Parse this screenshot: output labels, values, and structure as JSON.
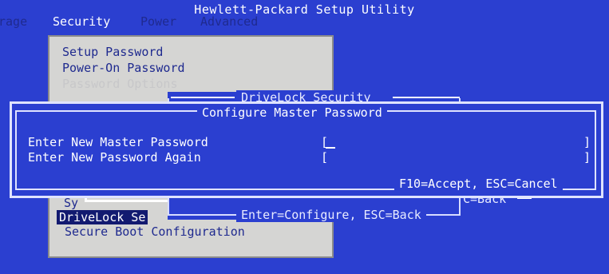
{
  "app": {
    "title": "Hewlett-Packard Setup Utility"
  },
  "menu": {
    "items": [
      {
        "label": "rage"
      },
      {
        "label": "Security"
      },
      {
        "label": "Power"
      },
      {
        "label": "Advanced"
      }
    ]
  },
  "security_menu": {
    "items": [
      {
        "label": "Setup Password"
      },
      {
        "label": "Power-On Password"
      },
      {
        "label": "Password Options"
      },
      {
        "label": "Sy"
      },
      {
        "label": "DriveLock Se"
      },
      {
        "label": "Secure Boot Configuration"
      }
    ]
  },
  "drivelock_dialog": {
    "title": "DriveLock Security",
    "footer": "Enter=Configure, ESC=Back"
  },
  "remnant": {
    "footer": "C=Back"
  },
  "master_password_dialog": {
    "title": "Configure Master Password",
    "fields": [
      {
        "label": "Enter New Master Password",
        "open": "[",
        "close": "]"
      },
      {
        "label": "Enter New Password Again",
        "open": "[",
        "close": "]"
      }
    ],
    "footer": "F10=Accept, ESC=Cancel"
  },
  "colors": {
    "background": "#2b3fd0",
    "panel": "#d5d5d3",
    "text_dark": "#1f2a8f",
    "text_light": "#ffffff"
  }
}
